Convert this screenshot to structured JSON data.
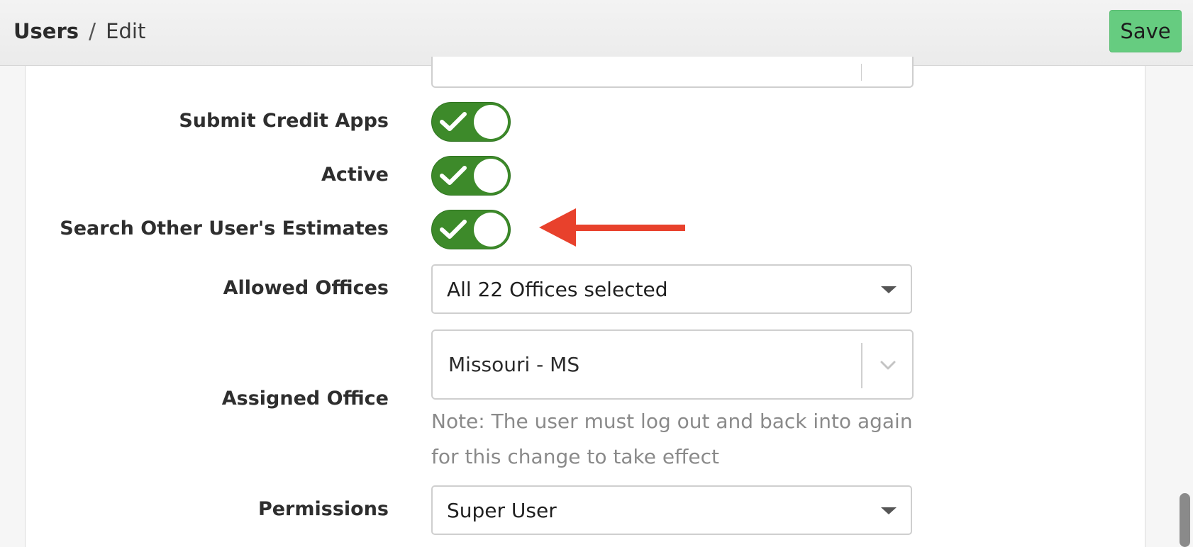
{
  "header": {
    "breadcrumb_root": "Users",
    "breadcrumb_separator": "/",
    "breadcrumb_current": "Edit",
    "save_label": "Save"
  },
  "form": {
    "submit_credit_apps": {
      "label": "Submit Credit Apps",
      "enabled": true
    },
    "active": {
      "label": "Active",
      "enabled": true
    },
    "search_other_estimates": {
      "label": "Search Other User's Estimates",
      "enabled": true
    },
    "allowed_offices": {
      "label": "Allowed Offices",
      "value": "All 22 Offices selected"
    },
    "assigned_office": {
      "label": "Assigned Office",
      "value": "Missouri - MS",
      "note": "Note: The user must log out and back into again for this change to take effect"
    },
    "permissions": {
      "label": "Permissions",
      "value": "Super User"
    }
  },
  "icons": {
    "toggle_check": "check-icon",
    "select_caret": "caret-down-icon",
    "combo_chevron": "chevron-down-icon",
    "annotation": "arrow-left-icon"
  },
  "colors": {
    "toggle_on": "#3d8a2a",
    "save_button": "#66cc80",
    "annotation_arrow": "#e8412c"
  }
}
